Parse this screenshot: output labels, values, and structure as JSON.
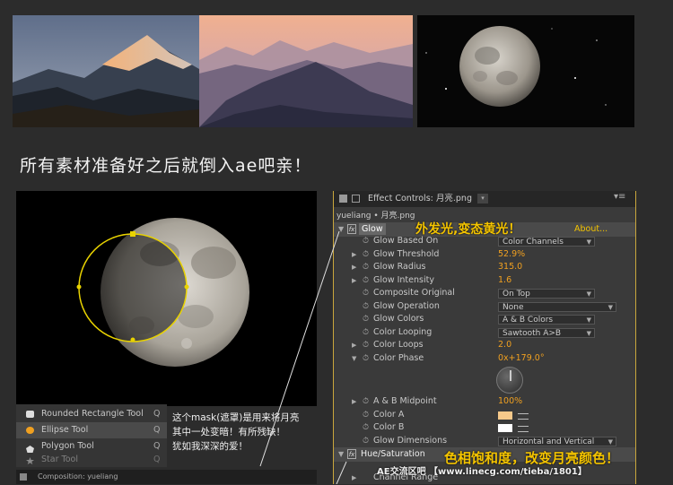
{
  "heading": "所有素材准备好之后就倒入ae吧亲！",
  "tools": {
    "items": [
      {
        "label": "Rounded Rectangle Tool",
        "key": "Q",
        "selected": false,
        "icon": "rounded-rectangle-icon"
      },
      {
        "label": "Ellipse Tool",
        "key": "Q",
        "selected": true,
        "icon": "ellipse-icon"
      },
      {
        "label": "Polygon Tool",
        "key": "Q",
        "selected": false,
        "icon": "polygon-icon"
      },
      {
        "label": "Star Tool",
        "key": "Q",
        "selected": false,
        "icon": "star-icon"
      }
    ],
    "composition_label": "Composition: yueliang"
  },
  "notes": [
    "这个mask(遮罩)是用来将月亮",
    "其中一处变暗！有所残缺！",
    "犹如我深深的爱！"
  ],
  "effect_controls": {
    "tab_title": "Effect Controls: 月亮.png",
    "layer_path": "yueliang • 月亮.png",
    "effect_name": "Glow",
    "about": "About...",
    "props": {
      "based_on": {
        "name": "Glow Based On",
        "value": "Color Channels"
      },
      "threshold": {
        "name": "Glow Threshold",
        "value": "52.9%"
      },
      "radius": {
        "name": "Glow Radius",
        "value": "315.0"
      },
      "intensity": {
        "name": "Glow Intensity",
        "value": "1.6"
      },
      "composite": {
        "name": "Composite Original",
        "value": "On Top"
      },
      "operation": {
        "name": "Glow Operation",
        "value": "None"
      },
      "colors": {
        "name": "Glow Colors",
        "value": "A & B Colors"
      },
      "looping": {
        "name": "Color Looping",
        "value": "Sawtooth A>B"
      },
      "loops": {
        "name": "Color Loops",
        "value": "2.0"
      },
      "phase": {
        "name": "Color Phase",
        "value": "0x+179.0°"
      },
      "midpoint": {
        "name": "A & B Midpoint",
        "value": "100%"
      },
      "color_a": {
        "name": "Color A",
        "swatch": "#f7c98a"
      },
      "color_b": {
        "name": "Color B",
        "swatch": "#ffffff"
      },
      "dimensions": {
        "name": "Glow Dimensions",
        "value": "Horizontal and Vertical"
      }
    },
    "effect2_name": "Hue/Saturation",
    "channel_range": "Channel Range"
  },
  "captions": {
    "glow": "外发光,变态黄光！",
    "hue": "色相饱和度，改变月亮颜色！",
    "watermark": "AE交流区吧 【www.linecg.com/tieba/1801】"
  },
  "colors": {
    "accent_yellow": "#f4c400",
    "value_orange": "#f0a020",
    "mask_yellow": "#e8d200"
  }
}
